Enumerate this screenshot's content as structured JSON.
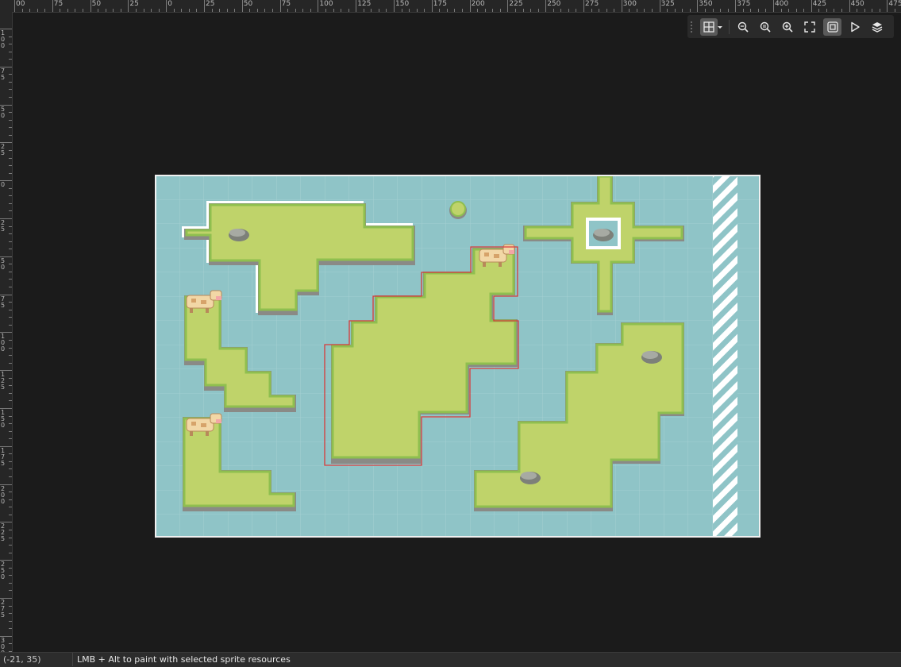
{
  "ruler": {
    "h_labels": [
      "00",
      "75",
      "50",
      "25",
      "0",
      "25",
      "50",
      "75",
      "100",
      "125",
      "150",
      "175",
      "200",
      "225",
      "250",
      "275",
      "300",
      "325",
      "350",
      "375",
      "400",
      "425",
      "450",
      "475"
    ],
    "v_labels": [
      "100",
      "75",
      "50",
      "25",
      "0",
      "25",
      "50",
      "75",
      "100",
      "125",
      "150",
      "175",
      "200",
      "225",
      "250",
      "275",
      "300"
    ]
  },
  "toolbar": {
    "items": [
      {
        "name": "grid-toggle-button",
        "icon": "grid-icon",
        "active": true
      },
      {
        "name": "grid-options-dropdown",
        "icon": "chevron-down-icon"
      },
      {
        "name": "zoom-out-button",
        "icon": "zoom-out-icon"
      },
      {
        "name": "zoom-reset-button",
        "icon": "zoom-reset-icon"
      },
      {
        "name": "zoom-in-button",
        "icon": "zoom-in-icon"
      },
      {
        "name": "fit-view-button",
        "icon": "fullscreen-icon"
      },
      {
        "name": "frame-toggle-button",
        "icon": "frame-icon",
        "active": true
      },
      {
        "name": "play-button",
        "icon": "play-icon"
      },
      {
        "name": "layers-button",
        "icon": "layers-icon"
      }
    ]
  },
  "colors": {
    "background": "#1b1b1b",
    "water": "#8fc4c7",
    "grass": "#bfd36a",
    "grass_edge": "#8fbf4f",
    "cliff": "#8a8a86",
    "selection": "#d83a3a"
  },
  "status": {
    "coords": "(-21, 35)",
    "hint": "LMB + Alt to paint with selected sprite resources"
  }
}
